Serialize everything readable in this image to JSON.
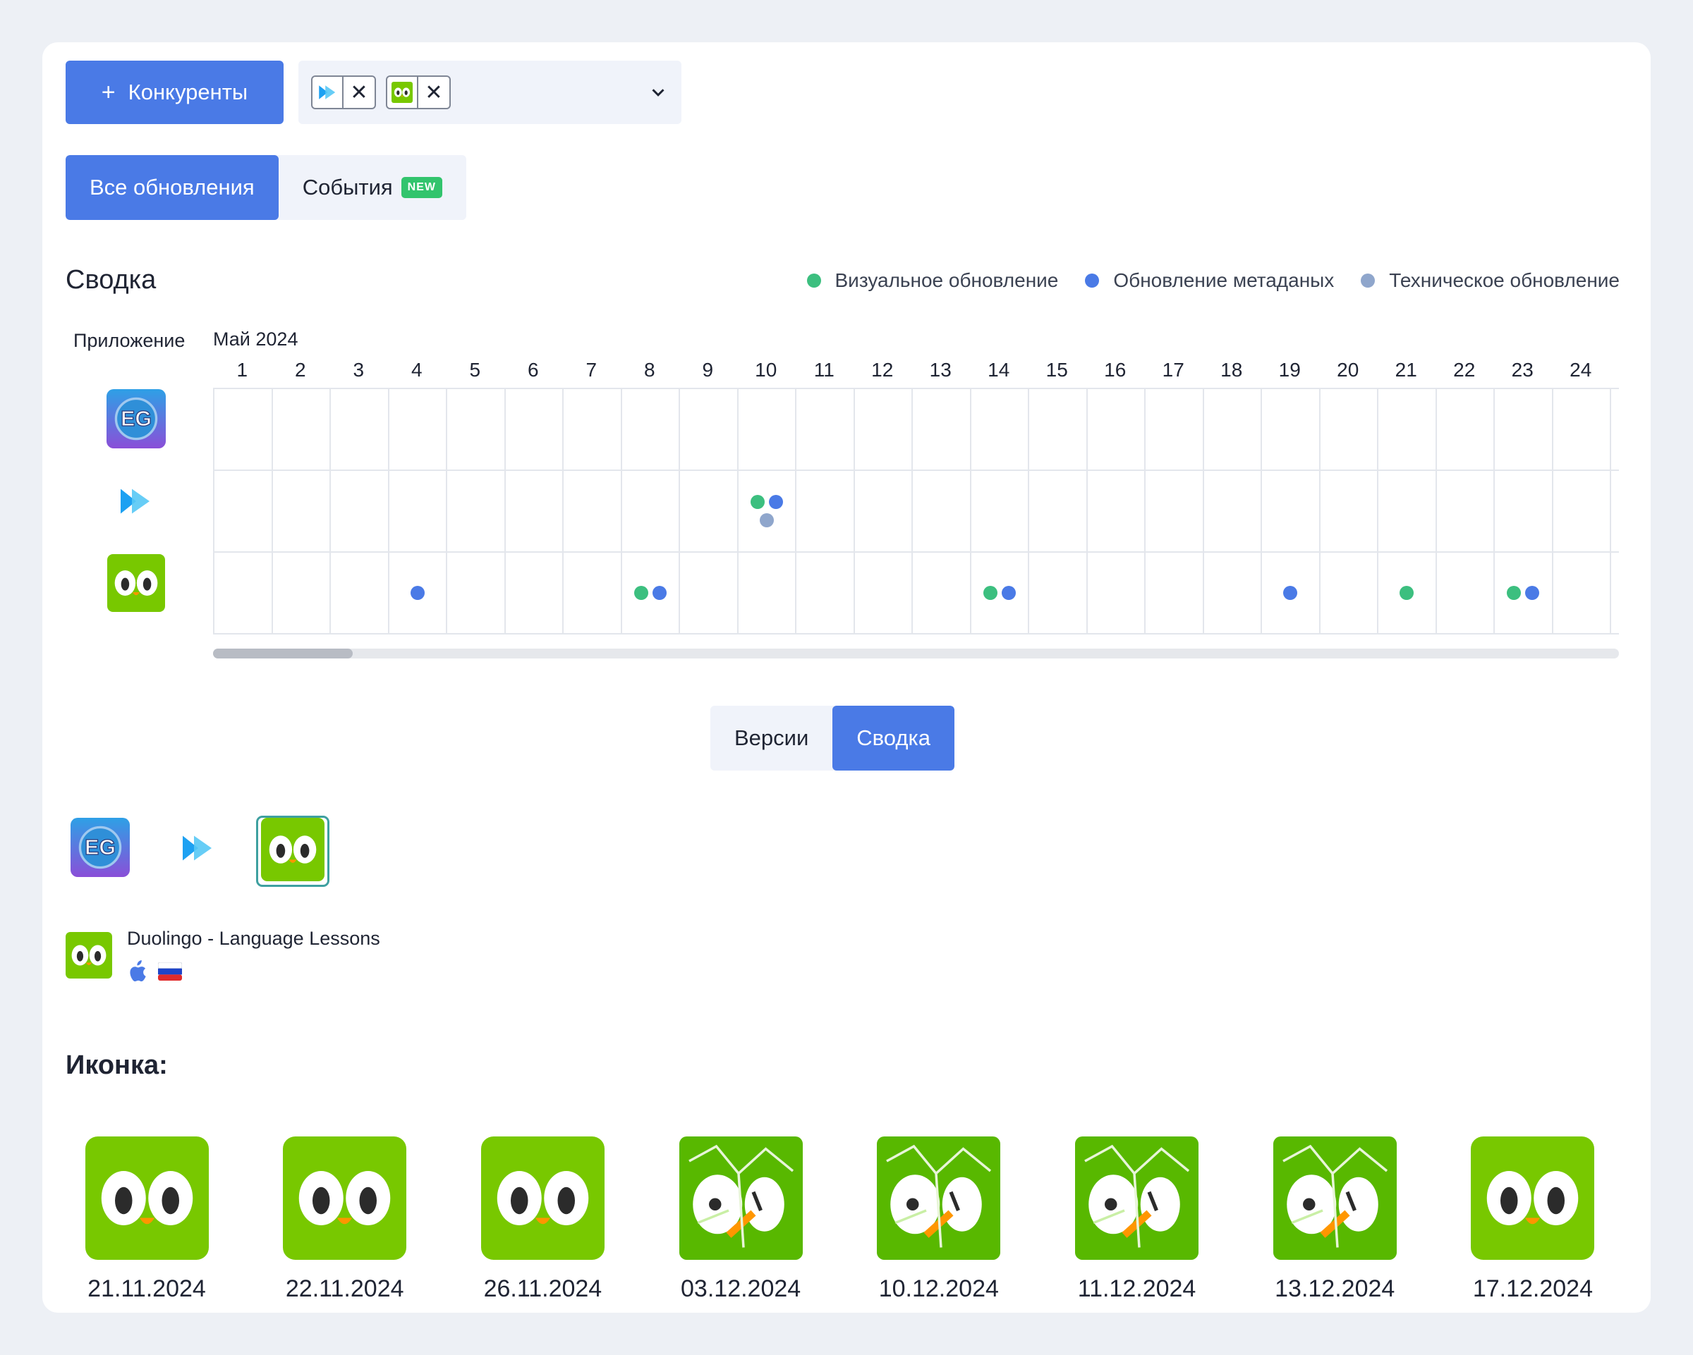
{
  "toolbar": {
    "competitors_label": "Конкуренты",
    "plus_glyph": "+",
    "chips": [
      {
        "icon": "play-app-icon",
        "remove": "✕"
      },
      {
        "icon": "duolingo-icon",
        "remove": "✕"
      }
    ]
  },
  "tabs_top": {
    "all_updates": "Все обновления",
    "events": "События",
    "events_badge": "NEW"
  },
  "summary": {
    "title": "Сводка",
    "legend": [
      {
        "label": "Визуальное обновление",
        "color": "#3cbf7f"
      },
      {
        "label": "Обновление метаданых",
        "color": "#4a7ae6"
      },
      {
        "label": "Техническое обновление",
        "color": "#8fa6cc"
      }
    ],
    "column_app": "Приложение",
    "month": "Май 2024",
    "days": [
      "1",
      "2",
      "3",
      "4",
      "5",
      "6",
      "7",
      "8",
      "9",
      "10",
      "11",
      "12",
      "13",
      "14",
      "15",
      "16",
      "17",
      "18",
      "19",
      "20",
      "21",
      "22",
      "23",
      "24"
    ],
    "apps": [
      {
        "icon": "eg-app-icon",
        "events": {}
      },
      {
        "icon": "play-app-icon",
        "events": {
          "10": [
            "visual",
            "metadata",
            "technical"
          ]
        }
      },
      {
        "icon": "duolingo-icon",
        "events": {
          "4": [
            "metadata"
          ],
          "8": [
            "visual",
            "metadata"
          ],
          "14": [
            "visual",
            "metadata"
          ],
          "19": [
            "metadata"
          ],
          "21": [
            "visual"
          ],
          "23": [
            "visual",
            "metadata"
          ]
        }
      }
    ]
  },
  "tabs_mid": {
    "versions": "Версии",
    "summary": "Сводка"
  },
  "app_info": {
    "name": "Duolingo - Language Lessons",
    "platform": "apple-icon",
    "country": "russia-flag-icon"
  },
  "icon_section": {
    "title": "Иконка:",
    "versions": [
      {
        "date": "21.11.2024",
        "variant": "normal"
      },
      {
        "date": "22.11.2024",
        "variant": "normal"
      },
      {
        "date": "26.11.2024",
        "variant": "normal"
      },
      {
        "date": "03.12.2024",
        "variant": "cracked"
      },
      {
        "date": "10.12.2024",
        "variant": "cracked"
      },
      {
        "date": "11.12.2024",
        "variant": "cracked"
      },
      {
        "date": "13.12.2024",
        "variant": "cracked"
      },
      {
        "date": "17.12.2024",
        "variant": "normal"
      }
    ]
  }
}
